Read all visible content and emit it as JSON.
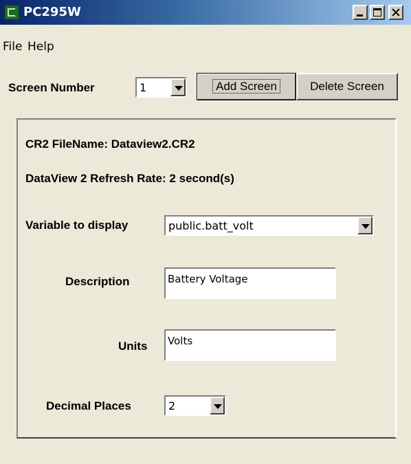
{
  "window": {
    "title": "PC295W"
  },
  "menu": {
    "items": [
      "File",
      "Help"
    ]
  },
  "screen_number": {
    "label": "Screen Number",
    "value": "1"
  },
  "buttons": {
    "add": "Add Screen",
    "delete": "Delete Screen"
  },
  "panel": {
    "cr2_filename": "CR2 FileName: Dataview2.CR2",
    "refresh_rate": "DataView 2 Refresh Rate: 2 second(s)",
    "variable": {
      "label": "Variable to display",
      "value": "public.batt_volt"
    },
    "description": {
      "label": "Description",
      "value": "Battery Voltage"
    },
    "units": {
      "label": "Units",
      "value": "Volts"
    },
    "decimal_places": {
      "label": "Decimal Places",
      "value": "2"
    }
  }
}
